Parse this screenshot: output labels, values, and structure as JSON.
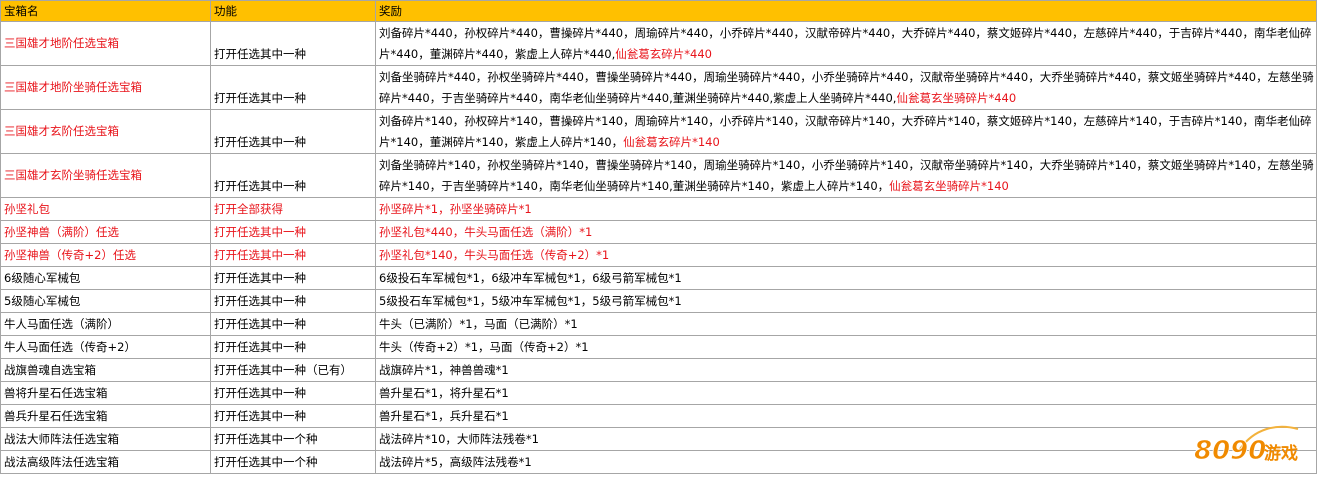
{
  "table": {
    "headers": [
      "宝箱名",
      "功能",
      "奖励"
    ],
    "rows": [
      {
        "name": "三国雄才地阶任选宝箱",
        "function": "打开任选其中一种",
        "reward_black": "刘备碎片*440，孙权碎片*440，曹操碎片*440，周瑜碎片*440，小乔碎片*440，汉献帝碎片*440，大乔碎片*440，蔡文姬碎片*440，左慈碎片*440，于吉碎片*440，南华老仙碎片*440，董渊碎片*440，紫虚上人碎片*440,",
        "reward_red": "仙瓮葛玄碎片*440"
      },
      {
        "name": "三国雄才地阶坐骑任选宝箱",
        "function": "打开任选其中一种",
        "reward_black": "刘备坐骑碎片*440，孙权坐骑碎片*440，曹操坐骑碎片*440，周瑜坐骑碎片*440，小乔坐骑碎片*440，汉献帝坐骑碎片*440，大乔坐骑碎片*440，蔡文姬坐骑碎片*440，左慈坐骑碎片*440，于吉坐骑碎片*440，南华老仙坐骑碎片*440,董渊坐骑碎片*440,紫虚上人坐骑碎片*440,",
        "reward_red": "仙瓮葛玄坐骑碎片*440"
      },
      {
        "name": "三国雄才玄阶任选宝箱",
        "function": "打开任选其中一种",
        "reward_black": "刘备碎片*140，孙权碎片*140，曹操碎片*140，周瑜碎片*140，小乔碎片*140，汉献帝碎片*140，大乔碎片*140，蔡文姬碎片*140，左慈碎片*140，于吉碎片*140，南华老仙碎片*140，董渊碎片*140，紫虚上人碎片*140，",
        "reward_red": "仙瓮葛玄碎片*140"
      },
      {
        "name": "三国雄才玄阶坐骑任选宝箱",
        "function": "打开任选其中一种",
        "reward_black": "刘备坐骑碎片*140，孙权坐骑碎片*140，曹操坐骑碎片*140，周瑜坐骑碎片*140，小乔坐骑碎片*140，汉献帝坐骑碎片*140，大乔坐骑碎片*140，蔡文姬坐骑碎片*140，左慈坐骑碎片*140，于吉坐骑碎片*140，南华老仙坐骑碎片*140,董渊坐骑碎片*140，紫虚上人碎片*140，",
        "reward_red": "仙瓮葛玄坐骑碎片*140"
      },
      {
        "name": "孙坚礼包",
        "function": "打开全部获得",
        "reward": "孙坚碎片*1，孙坚坐骑碎片*1"
      },
      {
        "name": "孙坚神兽（满阶）任选",
        "function": "打开任选其中一种",
        "reward": "孙坚礼包*440，牛头马面任选（满阶）*1"
      },
      {
        "name": "孙坚神兽（传奇+2）任选",
        "function": "打开任选其中一种",
        "reward": "孙坚礼包*140，牛头马面任选（传奇+2）*1"
      },
      {
        "name": "6级随心军械包",
        "function": "打开任选其中一种",
        "reward": "6级投石车军械包*1，6级冲车军械包*1，6级弓箭军械包*1"
      },
      {
        "name": "5级随心军械包",
        "function": "打开任选其中一种",
        "reward": "5级投石车军械包*1，5级冲车军械包*1，5级弓箭军械包*1"
      },
      {
        "name": "牛人马面任选（满阶）",
        "function": "打开任选其中一种",
        "reward": "牛头（已满阶）*1，马面（已满阶）*1"
      },
      {
        "name": "牛人马面任选（传奇+2）",
        "function": "打开任选其中一种",
        "reward": "牛头（传奇+2）*1，马面（传奇+2）*1"
      },
      {
        "name": "战旗兽魂自选宝箱",
        "function": "打开任选其中一种（已有）",
        "reward": "战旗碎片*1，神兽兽魂*1"
      },
      {
        "name": "兽将升星石任选宝箱",
        "function": "打开任选其中一种",
        "reward": "兽升星石*1，将升星石*1"
      },
      {
        "name": "兽兵升星石任选宝箱",
        "function": "打开任选其中一种",
        "reward": "兽升星石*1，兵升星石*1"
      },
      {
        "name": "战法大师阵法任选宝箱",
        "function": "打开任选其中一个种",
        "reward": "战法碎片*10，大师阵法残卷*1"
      },
      {
        "name": "战法高级阵法任选宝箱",
        "function": "打开任选其中一个种",
        "reward": "战法碎片*5，高级阵法残卷*1"
      }
    ]
  },
  "watermark": {
    "digits": "8090",
    "text": "游戏"
  },
  "colors": {
    "header_bg": "#ffc000",
    "red_text": "#e8141b",
    "border": "#a6a6a6",
    "logo_orange": "#f08a00"
  }
}
